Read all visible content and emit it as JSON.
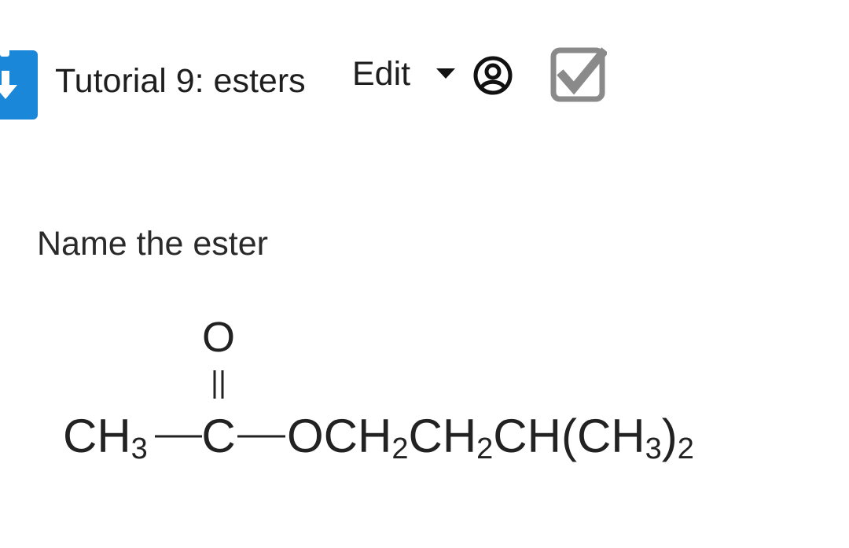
{
  "header": {
    "title": "Tutorial 9: esters",
    "edit_label": "Edit",
    "checkbox_checked": true
  },
  "colors": {
    "app_icon": "#1a87d8",
    "checkbox_gray": "#8a8a8a",
    "text": "#1e1e1e"
  },
  "icons": {
    "app": "clipboard-download-icon",
    "caret": "caret-down-icon",
    "user": "user-circle-icon",
    "checkbox": "checkbox-checked-icon"
  },
  "question": {
    "prompt": "Name the ester",
    "structure": {
      "carbonyl_oxygen": "O",
      "left_group": "CH",
      "left_group_sub": "3",
      "carbon": "C",
      "chain_O": "OCH",
      "chain_sub1": "2",
      "chain_2": "CH",
      "chain_sub2": "2",
      "chain_3": "CH(CH",
      "chain_sub3": "3",
      "chain_end": ")",
      "chain_sub4": "2"
    }
  }
}
